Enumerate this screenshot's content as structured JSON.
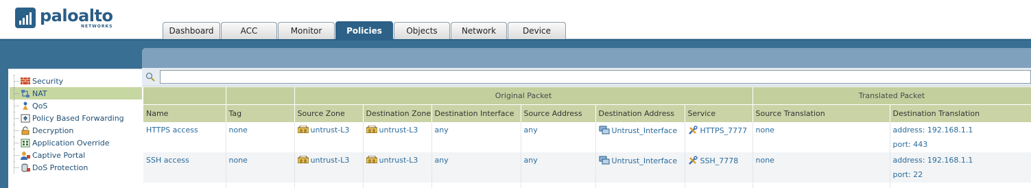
{
  "brand": {
    "name": "paloalto",
    "sub": "NETWORKS"
  },
  "tabs": [
    {
      "label": "Dashboard",
      "active": false
    },
    {
      "label": "ACC",
      "active": false
    },
    {
      "label": "Monitor",
      "active": false
    },
    {
      "label": "Policies",
      "active": true
    },
    {
      "label": "Objects",
      "active": false
    },
    {
      "label": "Network",
      "active": false
    },
    {
      "label": "Device",
      "active": false
    }
  ],
  "sidebar": {
    "items": [
      {
        "label": "Security",
        "icon": "firewall-icon",
        "selected": false
      },
      {
        "label": "NAT",
        "icon": "nat-icon",
        "selected": true
      },
      {
        "label": "QoS",
        "icon": "qos-icon",
        "selected": false
      },
      {
        "label": "Policy Based Forwarding",
        "icon": "pbf-icon",
        "selected": false
      },
      {
        "label": "Decryption",
        "icon": "lock-icon",
        "selected": false
      },
      {
        "label": "Application Override",
        "icon": "app-override-icon",
        "selected": false
      },
      {
        "label": "Captive Portal",
        "icon": "captive-portal-icon",
        "selected": false
      },
      {
        "label": "DoS Protection",
        "icon": "dos-protection-icon",
        "selected": false
      }
    ]
  },
  "search": {
    "placeholder": "",
    "value": ""
  },
  "table": {
    "groups": {
      "original": "Original Packet",
      "translated": "Translated Packet"
    },
    "columns": {
      "name": "Name",
      "tag": "Tag",
      "source_zone": "Source Zone",
      "destination_zone": "Destination Zone",
      "destination_interface": "Destination Interface",
      "source_address": "Source Address",
      "destination_address": "Destination Address",
      "service": "Service",
      "source_translation": "Source Translation",
      "destination_translation": "Destination Translation"
    },
    "rows": [
      {
        "name": "HTTPS access",
        "tag": "none",
        "source_zone": "untrust-L3",
        "destination_zone": "untrust-L3",
        "destination_interface": "any",
        "source_address": "any",
        "destination_address": "Untrust_Interface",
        "service": "HTTPS_7777",
        "source_translation": "none",
        "dest_translation_address": "address: 192.168.1.1",
        "dest_translation_port": "port: 443"
      },
      {
        "name": "SSH access",
        "tag": "none",
        "source_zone": "untrust-L3",
        "destination_zone": "untrust-L3",
        "destination_interface": "any",
        "source_address": "any",
        "destination_address": "Untrust_Interface",
        "service": "SSH_7778",
        "source_translation": "none",
        "dest_translation_address": "address: 192.168.1.1",
        "dest_translation_port": "port: 22"
      }
    ]
  },
  "colors": {
    "brand_blue": "#2a5d86",
    "band_blue": "#2d6187",
    "header_green": "#c9d3a6",
    "selected_green": "#c7d7a2",
    "link_blue": "#2a6b9a"
  }
}
